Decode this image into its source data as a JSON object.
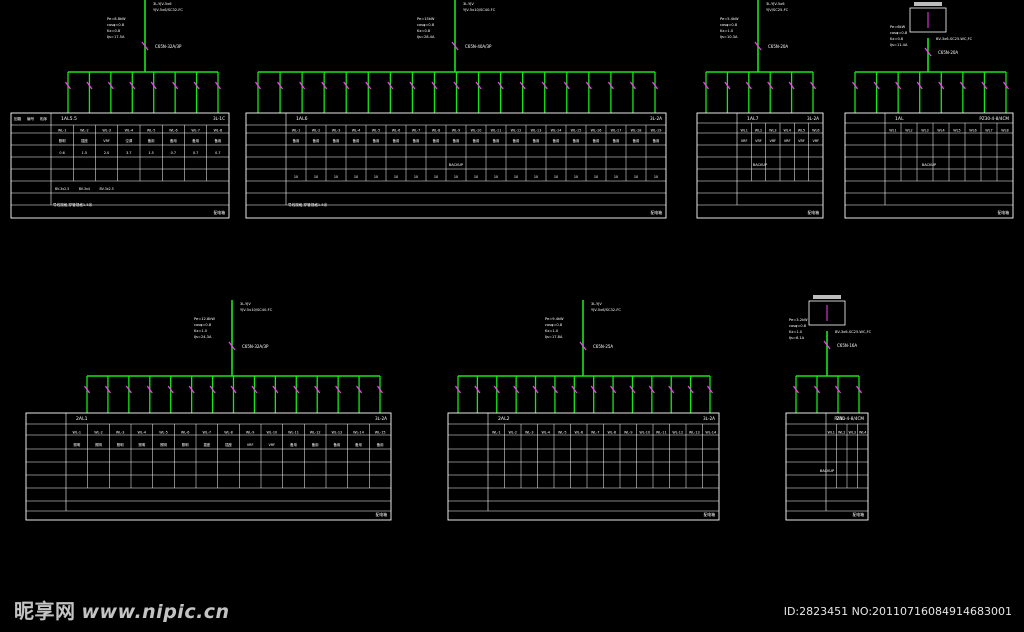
{
  "panels": [
    {
      "title": "1AL5.5",
      "code": "3L-1C",
      "row_headers": [
        "回路",
        "编号",
        "相序"
      ],
      "circuits": [
        "WL-1",
        "WL-2",
        "WL-3",
        "WL-4",
        "WL-5",
        "WL-6",
        "WL-7",
        "WL-8"
      ],
      "uses": [
        "照明",
        "插座",
        "VRF",
        "空调",
        "备用",
        "备用",
        "备用",
        "备用"
      ],
      "powers": [
        "0.6",
        "1.5",
        "2.0",
        "3.7",
        "1.5",
        "0.7",
        "0.7",
        "0.7"
      ],
      "cables": [
        "BV-3x2.5",
        "BV-3x4",
        "BV-3x2.5"
      ],
      "note": "导线规格,穿管规格1.5米",
      "sign": "配电箱",
      "incoming": [
        "Pe=8.8kW",
        "cosφ=0.8",
        "Kx=0.8",
        "Ijs=17.5A"
      ],
      "breaker": "C65N-32A/3P",
      "feed_top": "3L-YJV-5x6",
      "feed_mid": "YJV-5x6/SC32-FC"
    },
    {
      "title": "1AL6",
      "code": "3L-2A",
      "circuits": [
        "WL-1",
        "WL-2",
        "WL-3",
        "WL-4",
        "WL-5",
        "WL-6",
        "WL-7",
        "WL-8",
        "WL-9",
        "WL-10",
        "WL-11",
        "WL-12",
        "WL-13",
        "WL-14",
        "WL-15",
        "WL-16",
        "WL-17",
        "WL-18",
        "WL-19"
      ],
      "uses": [
        "备用",
        "备用",
        "备用",
        "备用",
        "备用",
        "备用",
        "备用",
        "备用",
        "备用",
        "备用",
        "备用",
        "备用",
        "备用",
        "备用",
        "备用",
        "备用",
        "备用",
        "备用",
        "备用"
      ],
      "mid_label": "BACKUP",
      "values": [
        "10",
        "10",
        "10",
        "10",
        "10",
        "10",
        "10",
        "10",
        "10",
        "10",
        "10",
        "10",
        "10",
        "10",
        "10",
        "10",
        "10",
        "10",
        "10"
      ],
      "note": "导线规格,穿管规格1.5米",
      "sign": "配电箱",
      "incoming": [
        "Pe=15kW",
        "cosφ=0.8",
        "Kx=0.8",
        "Ijs=28.4A"
      ],
      "breaker": "C65N-40A/3P",
      "feed_top": "3L-YJV",
      "feed_mid": "YJV-5x10/SC40-FC"
    },
    {
      "title": "1AL7",
      "code": "3L-2A",
      "circuits": [
        "WL1",
        "WL2",
        "WL3",
        "WL4",
        "WL5",
        "WL6"
      ],
      "uses": [
        "VRF",
        "VRF",
        "VRF",
        "VRF",
        "VRF",
        "VRF"
      ],
      "mid_label": "BACKUP",
      "sign": "配电箱",
      "incoming": [
        "Pe=5.4kW",
        "cosφ=0.8",
        "Kx=1.0",
        "Ijs=10.3A"
      ],
      "breaker": "C65N-20A",
      "feed_top": "3L-YJV-5x6",
      "feed_mid": "YJV/SC25-FC"
    },
    {
      "title": "1AL",
      "code": "PZ30-4-8/4CM",
      "circuits": [
        "WL1",
        "WL2",
        "WL3",
        "WL4",
        "WL5",
        "WL6",
        "WL7",
        "WL8"
      ],
      "mid_label": "BACKUP",
      "sign": "配电箱",
      "incoming": [
        "Pe=6kW",
        "cosφ=0.8",
        "Kx=0.8",
        "Ijs=11.4A"
      ],
      "breaker": "C65N-20A",
      "feed_mid": "BV-3x6-SC25-WC,FC"
    },
    {
      "title": "2AL1",
      "code": "3L-2A",
      "circuits": [
        "WL-1",
        "WL-2",
        "WL-3",
        "WL-4",
        "WL-5",
        "WL-6",
        "WL-7",
        "WL-8",
        "WL-9",
        "WL-10",
        "WL-11",
        "WL-12",
        "WL-13",
        "WL-14",
        "WL-15"
      ],
      "uses": [
        "照明",
        "照明",
        "照明",
        "照明",
        "照明",
        "照明",
        "插座",
        "插座",
        "VRF",
        "VRF",
        "备用",
        "备用",
        "备用",
        "备用",
        "备用"
      ],
      "sign": "配电箱",
      "incoming": [
        "Pe=12.8kW",
        "cosφ=0.8",
        "Kx=1.0",
        "Ijs=24.3A"
      ],
      "breaker": "C65N-32A/3P",
      "feed_top": "3L-YJV",
      "feed_mid": "YJV-5x10/SC40-FC"
    },
    {
      "title": "2AL2",
      "code": "3L-2A",
      "circuits": [
        "WL-1",
        "WL-2",
        "WL-3",
        "WL-4",
        "WL-5",
        "WL-6",
        "WL-7",
        "WL-8",
        "WL-9",
        "WL-10",
        "WL-11",
        "WL-12",
        "WL-13",
        "WL-14"
      ],
      "sign": "配电箱",
      "incoming": [
        "Pe=9.4kW",
        "cosφ=0.8",
        "Kx=1.0",
        "Ijs=17.8A"
      ],
      "breaker": "C65N-25A",
      "feed_top": "3L-YJV",
      "feed_mid": "YJV-5x6/SC32-FC"
    },
    {
      "title": "2AL",
      "code": "PZ30-4-8/4CM",
      "circuits": [
        "WL1",
        "WL2",
        "WL3",
        "WL4"
      ],
      "mid_label": "BACKUP",
      "sign": "配电箱",
      "incoming": [
        "Pe=3.2kW",
        "cosφ=0.8",
        "Kx=1.0",
        "Ijs=6.1A"
      ],
      "breaker": "C65N-16A",
      "feed_mid": "BV-3x6-SC25-WC,FC"
    }
  ],
  "watermark": {
    "cn": "昵享网",
    "url": "www.nipic.cn"
  },
  "image_id": "ID:2823451 NO:20110716084914683001",
  "colors": {
    "bus": "#16e816",
    "wire": "#ffffff",
    "switch": "#ff3cff",
    "text": "#ffffff"
  }
}
